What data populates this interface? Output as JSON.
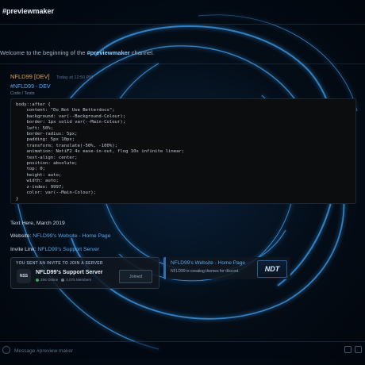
{
  "header": {
    "channel_label": "#previewmaker"
  },
  "welcome": {
    "prefix": "Welcome to the beginning of the ",
    "channel": "#previewmaker",
    "suffix": " channel."
  },
  "message": {
    "author": "NFLD99 [DEV]",
    "timestamp": "Today at 12:50 PM",
    "tag": "#NFLD99 - DEV",
    "sub": "Code / Tests",
    "code_lines": [
      "body::after {",
      "    content: \"Do Not Use Betterdocs\";",
      "    background: var(--Background-Colour);",
      "    border: 1px solid var(--Main-Colour);",
      "    left: 50%;",
      "    border-radius: 5px;",
      "    padding: 5px 10px;",
      "    transform: translate(-50%, -100%);",
      "    animation: NotiF2 4s ease-in-out, flog 10s infinite linear;",
      "    text-align: center;",
      "    position: absolute;",
      "    top: 0;",
      "    height: auto;",
      "    width: auto;",
      "    z-index: 9997;",
      "    color: var(--Main-Colour);",
      "}"
    ],
    "text_here": "Text Here, March 2019",
    "website_label": "Website: ",
    "website_link": "NFLD99's Website - Home Page",
    "invite_label": "Invite Link: ",
    "invite_link": "NFLD99's Support Server"
  },
  "invite_card": {
    "heading": "YOU SENT AN INVITE TO JOIN A SERVER",
    "icon_text": "NSS",
    "server_name": "NFLD99's Support Server",
    "online": "256 Online",
    "members": "2,075 Members",
    "button_label": "Joined"
  },
  "embed": {
    "title": "NFLD99's Website - Home Page",
    "description": "NFLD99 is creating themes for discord.",
    "thumb_text": "NDT"
  },
  "composer": {
    "placeholder": "Message #preview maker"
  },
  "colors": {
    "accent": "#5aa8e8",
    "author": "#e0a24a",
    "online": "#3ba55d"
  }
}
